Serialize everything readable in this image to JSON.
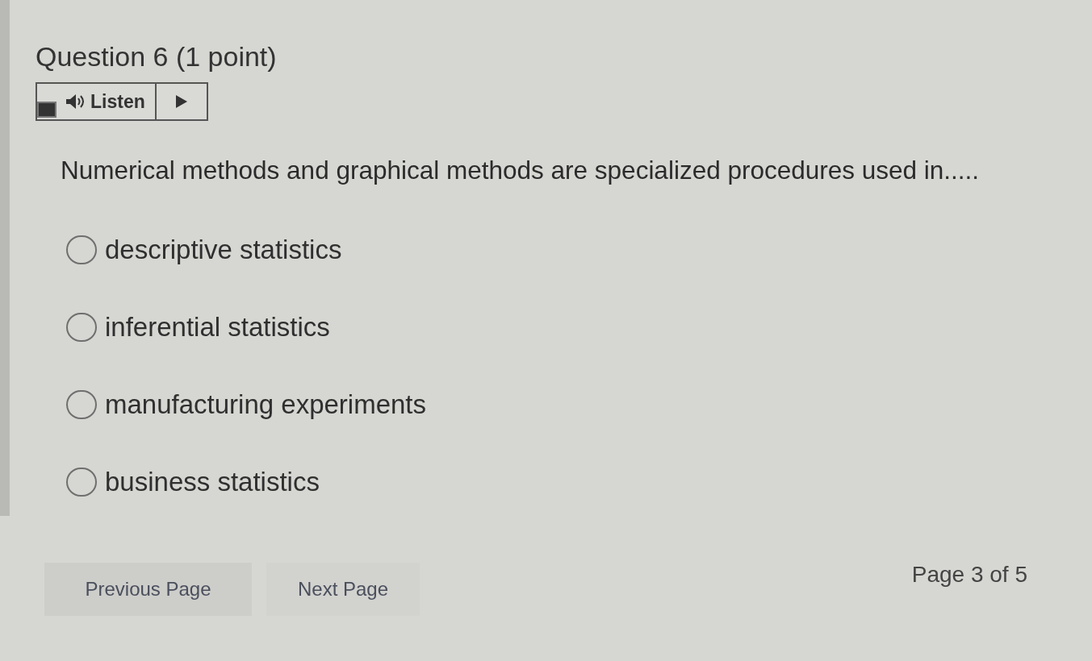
{
  "question": {
    "title": "Question 6 (1 point)",
    "listen": {
      "label": "Listen"
    },
    "prompt": "Numerical methods and graphical methods are specialized procedures used in.....",
    "options": [
      {
        "label": "descriptive statistics",
        "selected": false
      },
      {
        "label": "inferential statistics",
        "selected": false
      },
      {
        "label": "manufacturing experiments",
        "selected": false
      },
      {
        "label": "business statistics",
        "selected": false
      }
    ]
  },
  "navigation": {
    "buttons": [
      {
        "label": "Previous Page"
      },
      {
        "label": "Next Page"
      }
    ],
    "page_indicator": "Page 3 of 5"
  }
}
